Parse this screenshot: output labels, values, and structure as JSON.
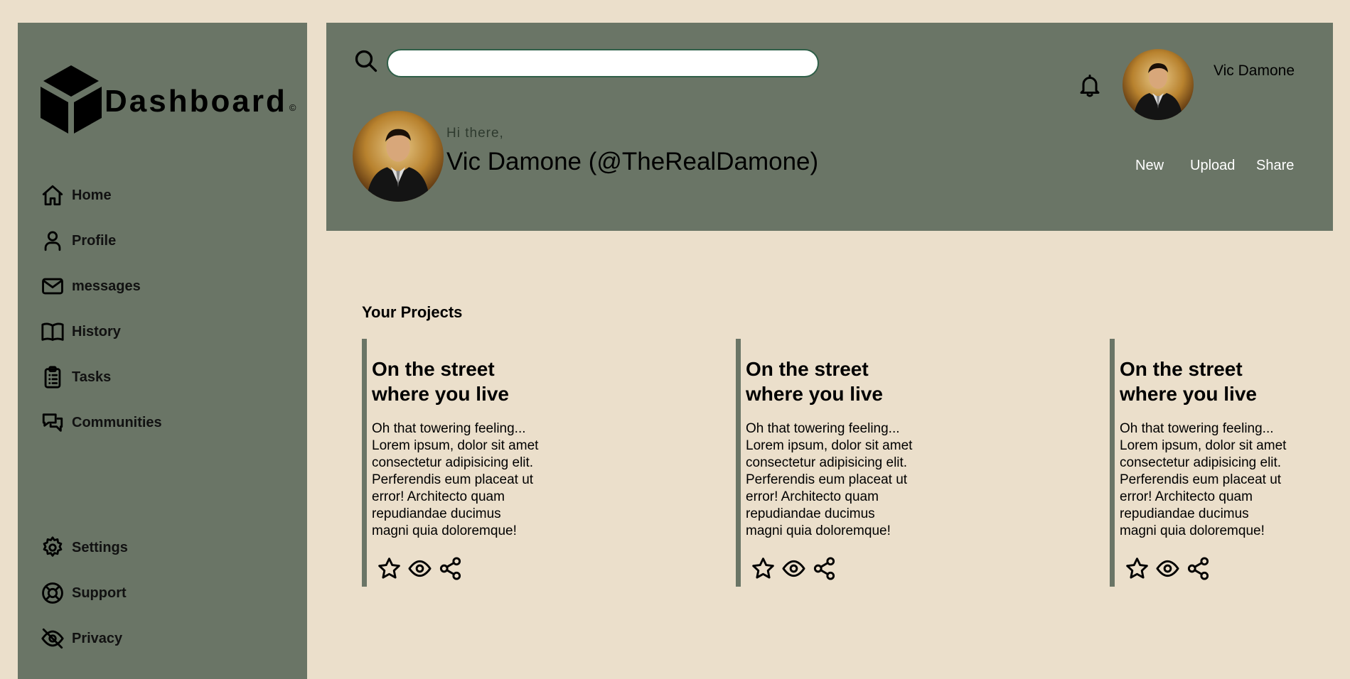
{
  "sidebar": {
    "brand": {
      "name": "Dashboard",
      "copyright": "©",
      "icon": "cube-icon"
    },
    "items": [
      {
        "label": "Home",
        "icon": "home-icon"
      },
      {
        "label": "Profile",
        "icon": "user-icon"
      },
      {
        "label": "messages",
        "icon": "mail-icon"
      },
      {
        "label": "History",
        "icon": "book-icon"
      },
      {
        "label": "Tasks",
        "icon": "clipboard-icon"
      },
      {
        "label": "Communities",
        "icon": "chat-icon"
      }
    ],
    "bottom_items": [
      {
        "label": "Settings",
        "icon": "gear-icon"
      },
      {
        "label": "Support",
        "icon": "lifebuoy-icon"
      },
      {
        "label": "Privacy",
        "icon": "eye-off-icon"
      }
    ]
  },
  "header": {
    "search": {
      "value": "",
      "placeholder": ""
    },
    "user": {
      "name": "Vic Damone"
    },
    "greeting": "Hi there,",
    "full_name": "Vic Damone (@TheRealDamone)",
    "actions": [
      "New",
      "Upload",
      "Share"
    ]
  },
  "projects": {
    "title": "Your Projects",
    "items": [
      {
        "title": "On the street\nwhere you live",
        "body": "Oh that towering feeling...\nLorem ipsum, dolor sit amet\nconsectetur adipisicing elit.\nPerferendis eum placeat ut\nerror! Architecto quam\nrepudiandae ducimus\nmagni quia doloremque!"
      },
      {
        "title": "On the street\nwhere you live",
        "body": "Oh that towering feeling...\nLorem ipsum, dolor sit amet\nconsectetur adipisicing elit.\nPerferendis eum placeat ut\nerror! Architecto quam\nrepudiandae ducimus\nmagni quia doloremque!"
      },
      {
        "title": "On the street\nwhere you live",
        "body": "Oh that towering feeling...\nLorem ipsum, dolor sit amet\nconsectetur adipisicing elit.\nPerferendis eum placeat ut\nerror! Architecto quam\nrepudiandae ducimus\nmagni quia doloremque!"
      }
    ],
    "card_icons": [
      "star-icon",
      "eye-icon",
      "share-icon"
    ]
  },
  "colors": {
    "background": "#ebdfcb",
    "panel": "#6a7566",
    "search_border": "#2f5f48"
  }
}
